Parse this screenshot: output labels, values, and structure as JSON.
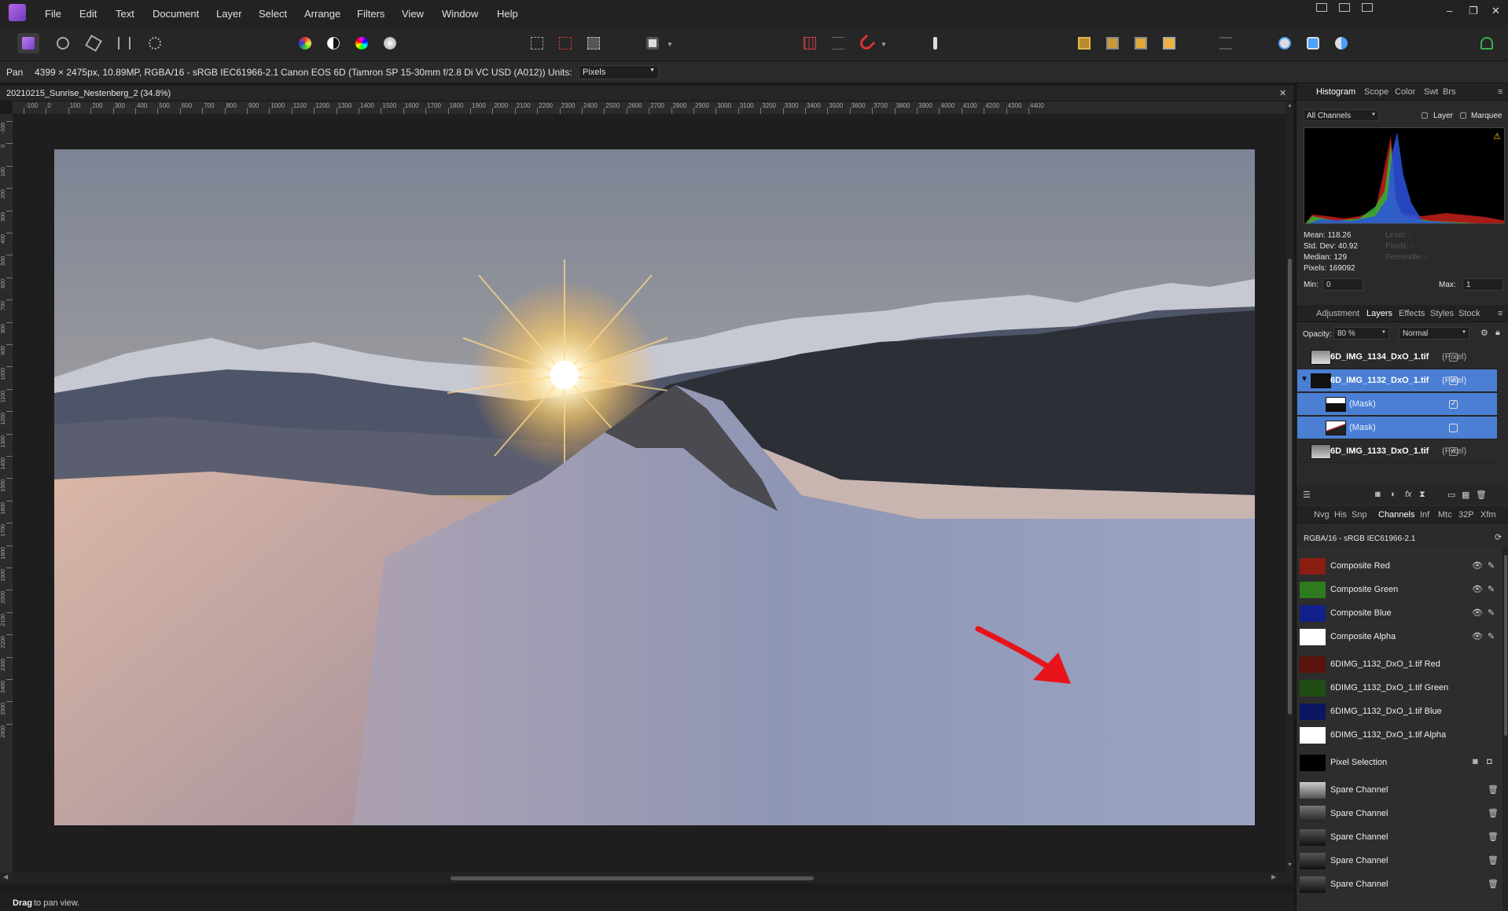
{
  "menu": {
    "items": [
      "File",
      "Edit",
      "Text",
      "Document",
      "Layer",
      "Select",
      "Arrange",
      "Filters",
      "View",
      "Window",
      "Help"
    ]
  },
  "window": {
    "minimize": "–",
    "restore": "❐",
    "close": "✕"
  },
  "context": {
    "tool": "Pan",
    "doc_info": "4399 × 2475px, 10.89MP, RGBA/16 - sRGB IEC61966-2.1",
    "camera_info": "Canon EOS 6D (Tamron SP 15-30mm f/2.8 Di VC USD (A012))",
    "units_label": "Units:",
    "units_value": "Pixels"
  },
  "document": {
    "tab_title": "20210215_Sunrise_Nestenberg_2 (34.8%)",
    "close": "✕"
  },
  "ruler": {
    "h_ticks": [
      "-100",
      "0",
      "100",
      "200",
      "300",
      "400",
      "500",
      "600",
      "700",
      "800",
      "900",
      "1000",
      "1100",
      "1200",
      "1300",
      "1400",
      "1500",
      "1600",
      "1700",
      "1800",
      "1900",
      "2000",
      "2100",
      "2200",
      "2300",
      "2400",
      "2500",
      "2600",
      "2700",
      "2800",
      "2900",
      "3000",
      "3100",
      "3200",
      "3300",
      "3400",
      "3500",
      "3600",
      "3700",
      "3800",
      "3900",
      "4000",
      "4100",
      "4200",
      "4300",
      "4400"
    ],
    "v_ticks": [
      "-100",
      "0",
      "100",
      "200",
      "300",
      "400",
      "500",
      "600",
      "700",
      "800",
      "900",
      "1000",
      "1100",
      "1200",
      "1300",
      "1400",
      "1500",
      "1600",
      "1700",
      "1800",
      "1900",
      "2000",
      "2100",
      "2200",
      "2300",
      "2400",
      "2500",
      "2600"
    ]
  },
  "status": {
    "bold": "Drag",
    "text": " to pan view."
  },
  "histogram_panel": {
    "tabs": [
      "Histogram",
      "Scope",
      "Color",
      "Swt",
      "Brs"
    ],
    "channel_select": "All Channels",
    "layer_label": "Layer",
    "marquee_label": "Marquee",
    "stats": [
      "Mean: 118.26",
      "Std. Dev: 40.92",
      "Median: 129",
      "Pixels: 169092"
    ],
    "stats_dim": [
      "Level: -",
      "Pixels: -",
      "Percentile: -"
    ],
    "min_label": "Min:",
    "min_value": "0",
    "max_label": "Max:",
    "max_value": "1"
  },
  "layers_panel": {
    "tabs": [
      "Adjustment",
      "Layers",
      "Effects",
      "Styles",
      "Stock"
    ],
    "opacity_label": "Opacity:",
    "opacity_value": "80 %",
    "blend_mode": "Normal",
    "layers": [
      {
        "name": "6D_IMG_1134_DxO_1.tif",
        "type": "(Pixel)",
        "checked": false,
        "selected": false,
        "indent": false
      },
      {
        "name": "6D_IMG_1132_DxO_1.tif",
        "type": "(Pixel)",
        "checked": true,
        "selected": true,
        "indent": false
      },
      {
        "name": "",
        "type": "(Mask)",
        "checked": true,
        "selected": true,
        "indent": true
      },
      {
        "name": "",
        "type": "(Mask)",
        "checked": false,
        "selected": true,
        "indent": true
      },
      {
        "name": "6D_IMG_1133_DxO_1.tif",
        "type": "(Pixel)",
        "checked": true,
        "selected": false,
        "indent": false
      }
    ]
  },
  "channels_panel": {
    "tabs": [
      "Nvg",
      "His",
      "Snp",
      "Channels",
      "Inf",
      "Mtc",
      "32P",
      "Xfm"
    ],
    "profile": "RGBA/16 - sRGB IEC61966-2.1",
    "composite": [
      {
        "name": "Composite Red",
        "color": "#8a1d12"
      },
      {
        "name": "Composite Green",
        "color": "#2f7a1e"
      },
      {
        "name": "Composite Blue",
        "color": "#12208c"
      },
      {
        "name": "Composite Alpha",
        "color": "#ffffff"
      }
    ],
    "layer_channels": [
      {
        "name": "6DIMG_1132_DxO_1.tif Red",
        "color": "#5a130d"
      },
      {
        "name": "6DIMG_1132_DxO_1.tif Green",
        "color": "#1f4d14"
      },
      {
        "name": "6DIMG_1132_DxO_1.tif Blue",
        "color": "#0c1660"
      },
      {
        "name": "6DIMG_1132_DxO_1.tif Alpha",
        "color": "#ffffff"
      }
    ],
    "pixel_selection": "Pixel Selection",
    "spare": [
      "Spare Channel",
      "Spare Channel",
      "Spare Channel",
      "Spare Channel",
      "Spare Channel"
    ]
  },
  "colors": {
    "accent": "#4a7fd4",
    "arrow": "#e8141b"
  }
}
